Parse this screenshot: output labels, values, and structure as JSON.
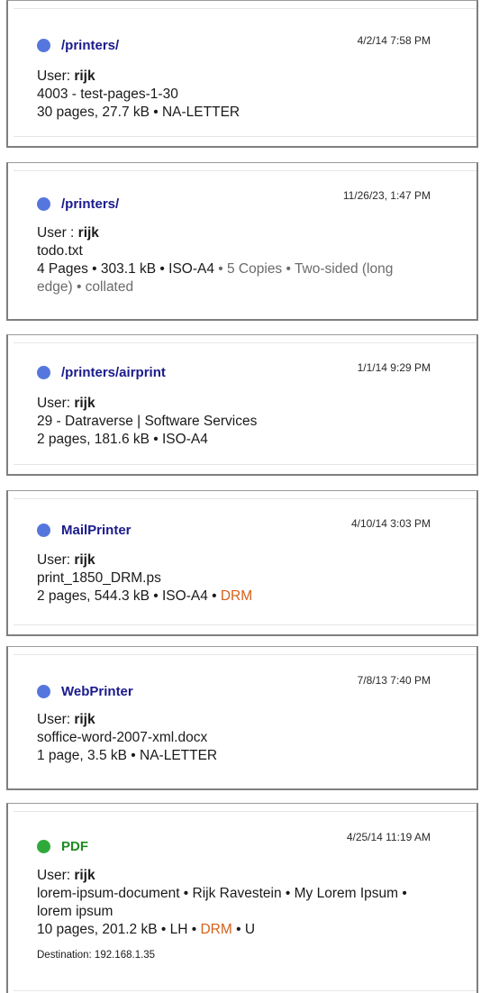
{
  "jobs": [
    {
      "printer": "/printers/",
      "dot_color": "#5577dd",
      "title_color": "#1a1a8c",
      "timestamp": "4/2/14 7:58 PM",
      "user_label": "User: ",
      "user": "rijk",
      "document": "4003 - test-pages-1-30",
      "details": "30 pages, 27.7 kB • NA-LETTER"
    },
    {
      "printer": "/printers/",
      "dot_color": "#5577dd",
      "title_color": "#1a1a8c",
      "timestamp": "11/26/23, 1:47 PM",
      "user_label": "User : ",
      "user": "rijk",
      "document": "todo.txt",
      "details": "4 Pages • 303.1 kB • ISO-A4",
      "details_extra": " • 5 Copies • Two-sided (long edge) • collated"
    },
    {
      "printer": "/printers/airprint",
      "dot_color": "#5577dd",
      "title_color": "#1a1a8c",
      "timestamp": "1/1/14 9:29 PM",
      "user_label": "User: ",
      "user": "rijk",
      "document": "29 - Datraverse | Software Services",
      "details": "2 pages, 181.6 kB • ISO-A4"
    },
    {
      "printer": "MailPrinter",
      "dot_color": "#5577dd",
      "title_color": "#1a1a8c",
      "timestamp": "4/10/14 3:03 PM",
      "user_label": "User: ",
      "user": "rijk",
      "document": "print_1850_DRM.ps",
      "details": "2 pages, 544.3 kB • ISO-A4 • ",
      "drm": "DRM"
    },
    {
      "printer": "WebPrinter",
      "dot_color": "#5577dd",
      "title_color": "#1a1a8c",
      "timestamp": "7/8/13 7:40 PM",
      "user_label": "User: ",
      "user": "rijk",
      "document": "soffice-word-2007-xml.docx",
      "details": "1 page, 3.5 kB • NA-LETTER"
    },
    {
      "printer": "PDF",
      "dot_color": "#2faa3a",
      "title_color": "#1f8a24",
      "timestamp": "4/25/14 11:19 AM",
      "user_label": "User: ",
      "user": "rijk",
      "document": "lorem-ipsum-document • Rijk Ravestein • My Lorem Ipsum • lorem ipsum",
      "details": "10 pages, 201.2 kB • LH • ",
      "drm": "DRM",
      "details_tail": " • U",
      "destination": "Destination: 192.168.1.35"
    }
  ]
}
